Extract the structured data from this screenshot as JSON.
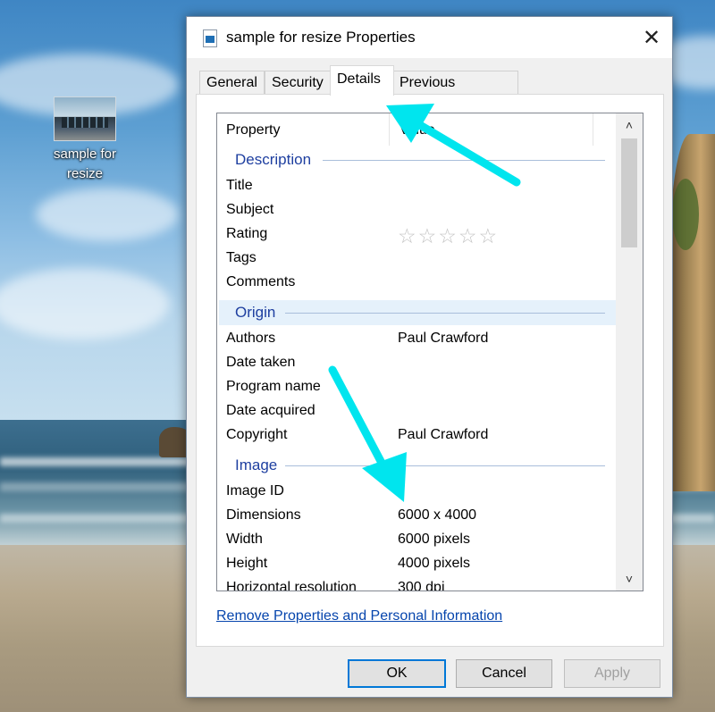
{
  "desktop": {
    "icon_label": "sample for resize"
  },
  "dialog": {
    "title": "sample for resize Properties",
    "close_glyph": "✕",
    "tabs": [
      "General",
      "Security",
      "Details",
      "Previous Versions"
    ],
    "active_tab": "Details",
    "columns": {
      "property": "Property",
      "value": "Value"
    },
    "groups": {
      "description": "Description",
      "origin": "Origin",
      "image": "Image"
    },
    "rows": {
      "title": {
        "k": "Title",
        "v": ""
      },
      "subject": {
        "k": "Subject",
        "v": ""
      },
      "rating": {
        "k": "Rating",
        "stars": "☆☆☆☆☆",
        "rating_value": 0,
        "rating_max": 5
      },
      "tags": {
        "k": "Tags",
        "v": ""
      },
      "comments": {
        "k": "Comments",
        "v": ""
      },
      "authors": {
        "k": "Authors",
        "v": "Paul Crawford"
      },
      "date_taken": {
        "k": "Date taken",
        "v": ""
      },
      "program_name": {
        "k": "Program name",
        "v": ""
      },
      "date_acquired": {
        "k": "Date acquired",
        "v": ""
      },
      "copyright": {
        "k": "Copyright",
        "v": "Paul Crawford"
      },
      "image_id": {
        "k": "Image ID",
        "v": ""
      },
      "dimensions": {
        "k": "Dimensions",
        "v": "6000 x 4000"
      },
      "width": {
        "k": "Width",
        "v": "6000 pixels"
      },
      "height": {
        "k": "Height",
        "v": "4000 pixels"
      },
      "hres": {
        "k": "Horizontal resolution",
        "v": "300 dpi"
      }
    },
    "scroll": {
      "up": "˄",
      "down": "˅"
    },
    "link": "Remove Properties and Personal Information",
    "buttons": {
      "ok": "OK",
      "cancel": "Cancel",
      "apply": "Apply"
    }
  },
  "colors": {
    "annotation_arrow": "#00e5ee",
    "link": "#0645ad",
    "group_label": "#1e3fa0",
    "ok_border": "#0078d7"
  }
}
